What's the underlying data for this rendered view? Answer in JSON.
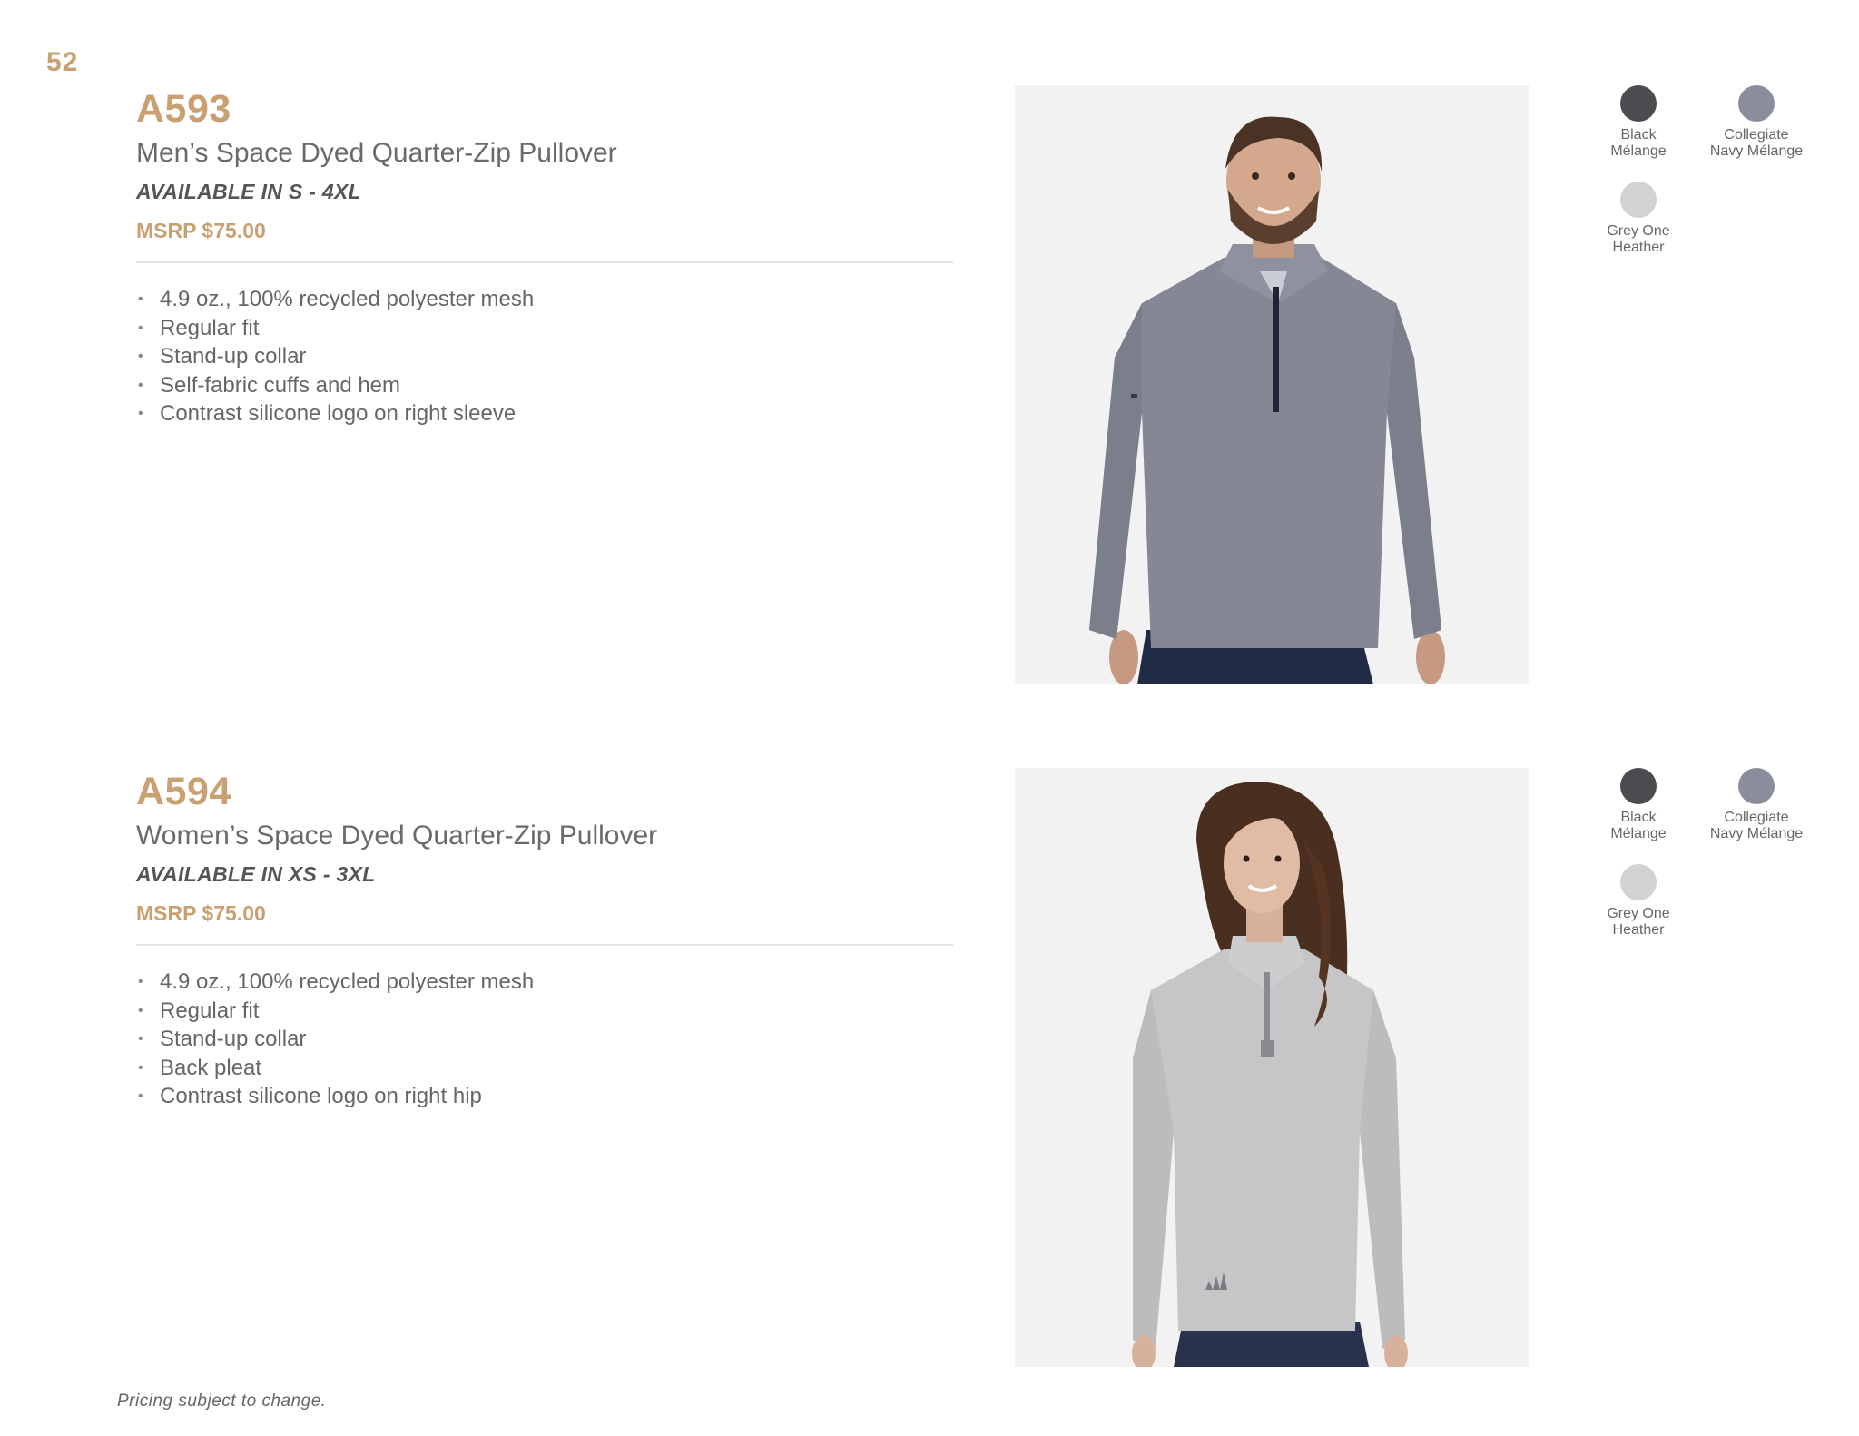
{
  "page_number": "52",
  "products": [
    {
      "code": "A593",
      "name": "Men’s Space Dyed Quarter-Zip Pullover",
      "sizes": "AVAILABLE IN S - 4XL",
      "price": "MSRP $75.00",
      "features": [
        "4.9 oz., 100% recycled polyester mesh",
        "Regular fit",
        "Stand-up collar",
        "Self-fabric cuffs and hem",
        "Contrast silicone logo on right sleeve"
      ],
      "colors": [
        {
          "line1": "Black",
          "line2": "Mélange",
          "hex": "#4b4c50"
        },
        {
          "line1": "Collegiate",
          "line2": "Navy Mélange",
          "hex": "#8a8d9c"
        },
        {
          "line1": "Grey One",
          "line2": "Heather",
          "hex": "#d2d2d2"
        }
      ],
      "garment_color": "#858894",
      "image": "man-model-photo"
    },
    {
      "code": "A594",
      "name": "Women’s Space Dyed Quarter-Zip Pullover",
      "sizes": "AVAILABLE IN XS - 3XL",
      "price": "MSRP $75.00",
      "features": [
        "4.9 oz., 100% recycled polyester mesh",
        "Regular fit",
        "Stand-up collar",
        "Back pleat",
        "Contrast silicone logo on right hip"
      ],
      "colors": [
        {
          "line1": "Black",
          "line2": "Mélange",
          "hex": "#4b4c50"
        },
        {
          "line1": "Collegiate",
          "line2": "Navy Mélange",
          "hex": "#8a8d9c"
        },
        {
          "line1": "Grey One",
          "line2": "Heather",
          "hex": "#d2d2d2"
        }
      ],
      "garment_color": "#c6c6c8",
      "image": "woman-model-photo"
    }
  ],
  "footnote": "Pricing subject to change."
}
